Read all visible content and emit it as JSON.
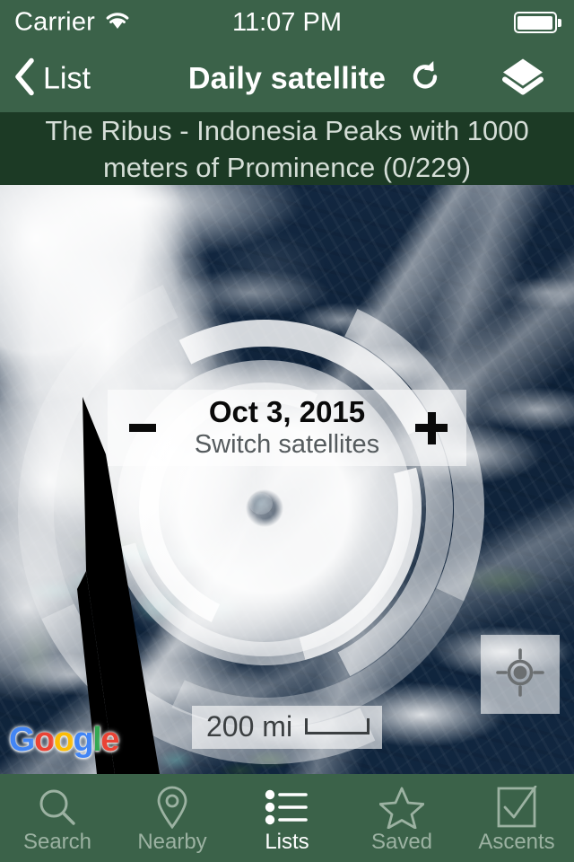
{
  "status_bar": {
    "carrier": "Carrier",
    "wifi_icon": "wifi-icon",
    "clock": "11:07 PM",
    "battery_icon": "battery-icon"
  },
  "nav_bar": {
    "back_icon": "chevron-left-icon",
    "back_label": "List",
    "title": "Daily satellite",
    "refresh_icon": "refresh-icon",
    "layers_icon": "layers-icon"
  },
  "list_banner": {
    "text": "The Ribus - Indonesia Peaks with 1000 meters of Prominence (0/229)"
  },
  "map": {
    "date_panel": {
      "minus_label": "-",
      "date": "Oct 3, 2015",
      "subtitle": "Switch satellites",
      "plus_label": "+"
    },
    "attribution": {
      "letters": [
        "G",
        "o",
        "o",
        "g",
        "l",
        "e"
      ]
    },
    "scale": {
      "distance": "200 mi"
    },
    "locate_icon": "my-location-icon"
  },
  "tab_bar": {
    "items": [
      {
        "label": "Search",
        "icon": "search-icon",
        "active": false
      },
      {
        "label": "Nearby",
        "icon": "map-pin-icon",
        "active": false
      },
      {
        "label": "Lists",
        "icon": "list-icon",
        "active": true
      },
      {
        "label": "Saved",
        "icon": "star-icon",
        "active": false
      },
      {
        "label": "Ascents",
        "icon": "checkbox-icon",
        "active": false
      }
    ]
  },
  "colors": {
    "nav_green": "#3B6249",
    "banner_green": "#1C3A25",
    "tab_inactive": "#9CB2A2",
    "tab_active": "#FFFFFF",
    "ocean_navy": "#11253C",
    "shallow_turquoise": "#3CC8BE"
  }
}
